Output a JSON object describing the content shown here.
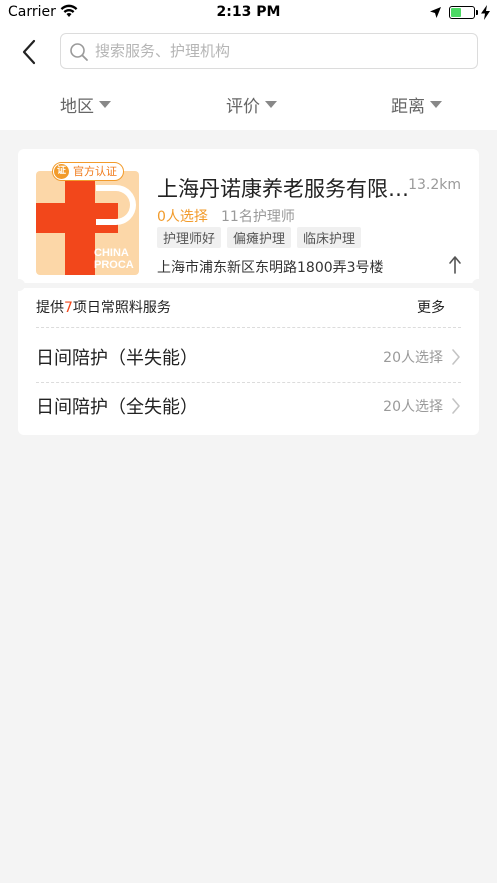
{
  "status_bar": {
    "carrier": "Carrier",
    "time": "2:13 PM",
    "battery_level": 0.45
  },
  "search": {
    "placeholder": "搜索服务、护理机构",
    "value": ""
  },
  "filters": [
    {
      "label": "地区"
    },
    {
      "label": "评价"
    },
    {
      "label": "距离"
    }
  ],
  "org": {
    "badge": "官方认证",
    "badge_icon_text": "证",
    "logo_text": [
      "CHINA",
      "PROCA"
    ],
    "name": "上海丹诺康养老服务有限公司",
    "distance": "13.2km",
    "selections": "0人选择",
    "nurses": "11名护理师",
    "tags": [
      "护理师好",
      "偏瘫护理",
      "临床护理"
    ],
    "address": "上海市浦东新区东明路1800弄3号楼"
  },
  "services": {
    "header_prefix": "提供",
    "count": "7",
    "header_suffix": "项日常照料服务",
    "more_label": "更多",
    "items": [
      {
        "name": "日间陪护（半失能）",
        "selections": "20人选择"
      },
      {
        "name": "日间陪护（全失能）",
        "selections": "20人选择"
      }
    ]
  },
  "colors": {
    "accent": "#f29b2b",
    "brand_red": "#f2471b",
    "battery_green": "#4cd964"
  },
  "icons": [
    "wifi-icon",
    "location-arrow-icon",
    "battery-icon",
    "charging-icon",
    "back-chevron-icon",
    "search-icon",
    "caret-down-icon",
    "navigate-icon",
    "chevron-right-icon"
  ]
}
